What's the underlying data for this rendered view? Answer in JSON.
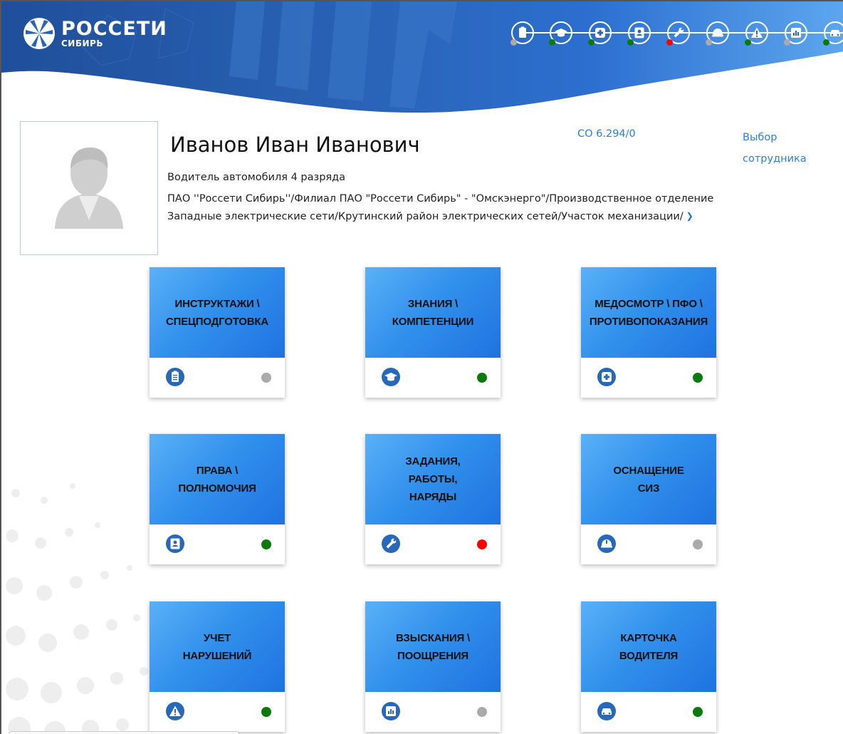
{
  "brand": {
    "name": "РОССЕТИ",
    "sub": "СИБИРЬ"
  },
  "colors": {
    "accent": "#2a7de1",
    "tile_blue": "#3291ec",
    "status_green": "#0a7a0a",
    "status_red": "#ff0000",
    "status_gray": "#aaaaaa"
  },
  "steps": [
    {
      "icon": "clipboard-icon",
      "status": "gray"
    },
    {
      "icon": "graduation-cap-icon",
      "status": "green"
    },
    {
      "icon": "medical-cross-icon",
      "status": "green"
    },
    {
      "icon": "id-badge-icon",
      "status": "green"
    },
    {
      "icon": "wrench-icon",
      "status": "red"
    },
    {
      "icon": "helmet-icon",
      "status": "gray"
    },
    {
      "icon": "warning-icon",
      "status": "green"
    },
    {
      "icon": "chart-icon",
      "status": "gray"
    },
    {
      "icon": "car-icon",
      "status": "green"
    }
  ],
  "employee": {
    "name": "Иванов Иван Иванович",
    "position": "Водитель автомобиля 4 разряда",
    "org_line1": "ПАО ''Россети Сибирь''/Филиал ПАО \"Россети Сибирь\" - \"Омскэнерго\"/Производственное отделение",
    "org_line2": "Западные электрические сети/Крутинский район электрических сетей/Участок механизации/",
    "code": "СО 6.294/0",
    "select_label": "Выбор сотрудника"
  },
  "tiles": [
    {
      "title": "ИНСТРУКТАЖИ \\\nСПЕЦПОДГОТОВКА",
      "icon": "clipboard-icon",
      "status": "gray"
    },
    {
      "title": "ЗНАНИЯ \\\nКОМПЕТЕНЦИИ",
      "icon": "graduation-cap-icon",
      "status": "green"
    },
    {
      "title": "МЕДОСМОТР \\ ПФО \\\nПРОТИВОПОКАЗАНИЯ",
      "icon": "medical-cross-icon",
      "status": "green"
    },
    {
      "title": "ПРАВА \\\nПОЛНОМОЧИЯ",
      "icon": "id-badge-icon",
      "status": "green"
    },
    {
      "title": "ЗАДАНИЯ,\nРАБОТЫ,\nНАРЯДЫ",
      "icon": "wrench-icon",
      "status": "red"
    },
    {
      "title": "ОСНАЩЕНИЕ\nСИЗ",
      "icon": "helmet-icon",
      "status": "gray"
    },
    {
      "title": "УЧЕТ\nНАРУШЕНИЙ",
      "icon": "warning-icon",
      "status": "green"
    },
    {
      "title": "ВЗЫСКАНИЯ \\\nПООЩРЕНИЯ",
      "icon": "chart-icon",
      "status": "gray"
    },
    {
      "title": "КАРТОЧКА\nВОДИТЕЛЯ",
      "icon": "car-icon",
      "status": "green"
    }
  ]
}
